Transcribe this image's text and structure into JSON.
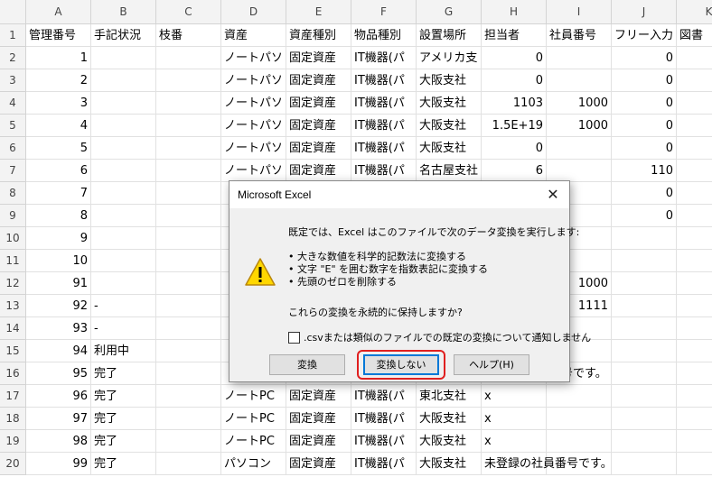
{
  "columns": [
    "A",
    "B",
    "C",
    "D",
    "E",
    "F",
    "G",
    "H",
    "I",
    "J",
    "K"
  ],
  "rows": [
    {
      "n": "1",
      "A": "管理番号",
      "B": "手記状況",
      "C": "枝番",
      "D": "資産",
      "E": "資産種別",
      "F": "物品種別",
      "G": "設置場所",
      "H": "担当者",
      "I": "社員番号",
      "J": "フリー入力",
      "K": "図書"
    },
    {
      "n": "2",
      "A": "1",
      "B": "",
      "C": "",
      "D": "ノートパソ",
      "E": "固定資産",
      "F": "IT機器(パ",
      "G": "アメリカ支",
      "H": "0",
      "I": "",
      "J": "0",
      "K": ""
    },
    {
      "n": "3",
      "A": "2",
      "B": "",
      "C": "",
      "D": "ノートパソ",
      "E": "固定資産",
      "F": "IT機器(パ",
      "G": "大阪支社",
      "H": "0",
      "I": "",
      "J": "0",
      "K": ""
    },
    {
      "n": "4",
      "A": "3",
      "B": "",
      "C": "",
      "D": "ノートパソ",
      "E": "固定資産",
      "F": "IT機器(パ",
      "G": "大阪支社",
      "H": "1103",
      "I": "1000",
      "J": "0",
      "K": ""
    },
    {
      "n": "5",
      "A": "4",
      "B": "",
      "C": "",
      "D": "ノートパソ",
      "E": "固定資産",
      "F": "IT機器(パ",
      "G": "大阪支社",
      "H": "1.5E+19",
      "I": "1000",
      "J": "0",
      "K": ""
    },
    {
      "n": "6",
      "A": "5",
      "B": "",
      "C": "",
      "D": "ノートパソ",
      "E": "固定資産",
      "F": "IT機器(パ",
      "G": "大阪支社",
      "H": "0",
      "I": "",
      "J": "0",
      "K": ""
    },
    {
      "n": "7",
      "A": "6",
      "B": "",
      "C": "",
      "D": "ノートパソ",
      "E": "固定資産",
      "F": "IT機器(パ",
      "G": "名古屋支社",
      "H": "6",
      "I": "",
      "J": "110",
      "K": ""
    },
    {
      "n": "8",
      "A": "7",
      "B": "",
      "C": "",
      "D": "",
      "E": "",
      "F": "",
      "G": "",
      "H": "",
      "I": "",
      "J": "0",
      "K": ""
    },
    {
      "n": "9",
      "A": "8",
      "B": "",
      "C": "",
      "D": "",
      "E": "",
      "F": "",
      "G": "",
      "H": "",
      "I": "",
      "J": "0",
      "K": ""
    },
    {
      "n": "10",
      "A": "9",
      "B": "",
      "C": "",
      "D": "",
      "E": "",
      "F": "",
      "G": "",
      "H": "",
      "I": "",
      "J": "",
      "K": ""
    },
    {
      "n": "11",
      "A": "10",
      "B": "",
      "C": "",
      "D": "",
      "E": "",
      "F": "",
      "G": "",
      "H": "",
      "I": "",
      "J": "",
      "K": ""
    },
    {
      "n": "12",
      "A": "91",
      "B": "",
      "C": "",
      "D": "",
      "E": "",
      "F": "",
      "G": "",
      "H": "",
      "I": "1000",
      "J": "",
      "K": ""
    },
    {
      "n": "13",
      "A": "92",
      "B": "-",
      "C": "",
      "D": "",
      "E": "",
      "F": "",
      "G": "",
      "H": "",
      "I": "1111",
      "J": "",
      "K": ""
    },
    {
      "n": "14",
      "A": "93",
      "B": "-",
      "C": "",
      "D": "",
      "E": "",
      "F": "",
      "G": "",
      "H": "",
      "I": "",
      "J": "",
      "K": ""
    },
    {
      "n": "15",
      "A": "94",
      "B": "利用中",
      "C": "",
      "D": "",
      "E": "",
      "F": "",
      "G": "",
      "H": "",
      "I": "",
      "J": "",
      "K": ""
    },
    {
      "n": "16",
      "A": "95",
      "B": "完了",
      "C": "",
      "D": "",
      "E": "",
      "F": "",
      "G": "",
      "H": "",
      "I": "番号です。",
      "J": "",
      "K": ""
    },
    {
      "n": "17",
      "A": "96",
      "B": "完了",
      "C": "",
      "D": "ノートPC",
      "E": "固定資産",
      "F": "IT機器(パ",
      "G": "東北支社",
      "H": "x",
      "I": "",
      "J": "",
      "K": ""
    },
    {
      "n": "18",
      "A": "97",
      "B": "完了",
      "C": "",
      "D": "ノートPC",
      "E": "固定資産",
      "F": "IT機器(パ",
      "G": "大阪支社",
      "H": "x",
      "I": "",
      "J": "",
      "K": ""
    },
    {
      "n": "19",
      "A": "98",
      "B": "完了",
      "C": "",
      "D": "ノートPC",
      "E": "固定資産",
      "F": "IT機器(パ",
      "G": "大阪支社",
      "H": "x",
      "I": "",
      "J": "",
      "K": ""
    },
    {
      "n": "20",
      "A": "99",
      "B": "完了",
      "C": "",
      "D": "パソコン",
      "E": "固定資産",
      "F": "IT機器(パ",
      "G": "大阪支社",
      "H": "未登録の社員番号です。",
      "I": "",
      "J": "",
      "K": ""
    }
  ],
  "dialog": {
    "title": "Microsoft Excel",
    "close": "✕",
    "intro": "既定では、Excel はこのファイルで次のデータ変換を実行します:",
    "bullets": [
      "• 大きな数値を科学的記数法に変換する",
      "• 文字 \"E\" を囲む数字を指数表記に変換する",
      "• 先頭のゼロを削除する"
    ],
    "question": "これらの変換を永続的に保持しますか?",
    "checkbox_label": ".csvまたは類似のファイルでの既定の変換について通知しません",
    "btn_convert": "変換",
    "btn_no_convert": "変換しない",
    "btn_help": "ヘルプ(H)",
    "icon": "warning-icon"
  }
}
